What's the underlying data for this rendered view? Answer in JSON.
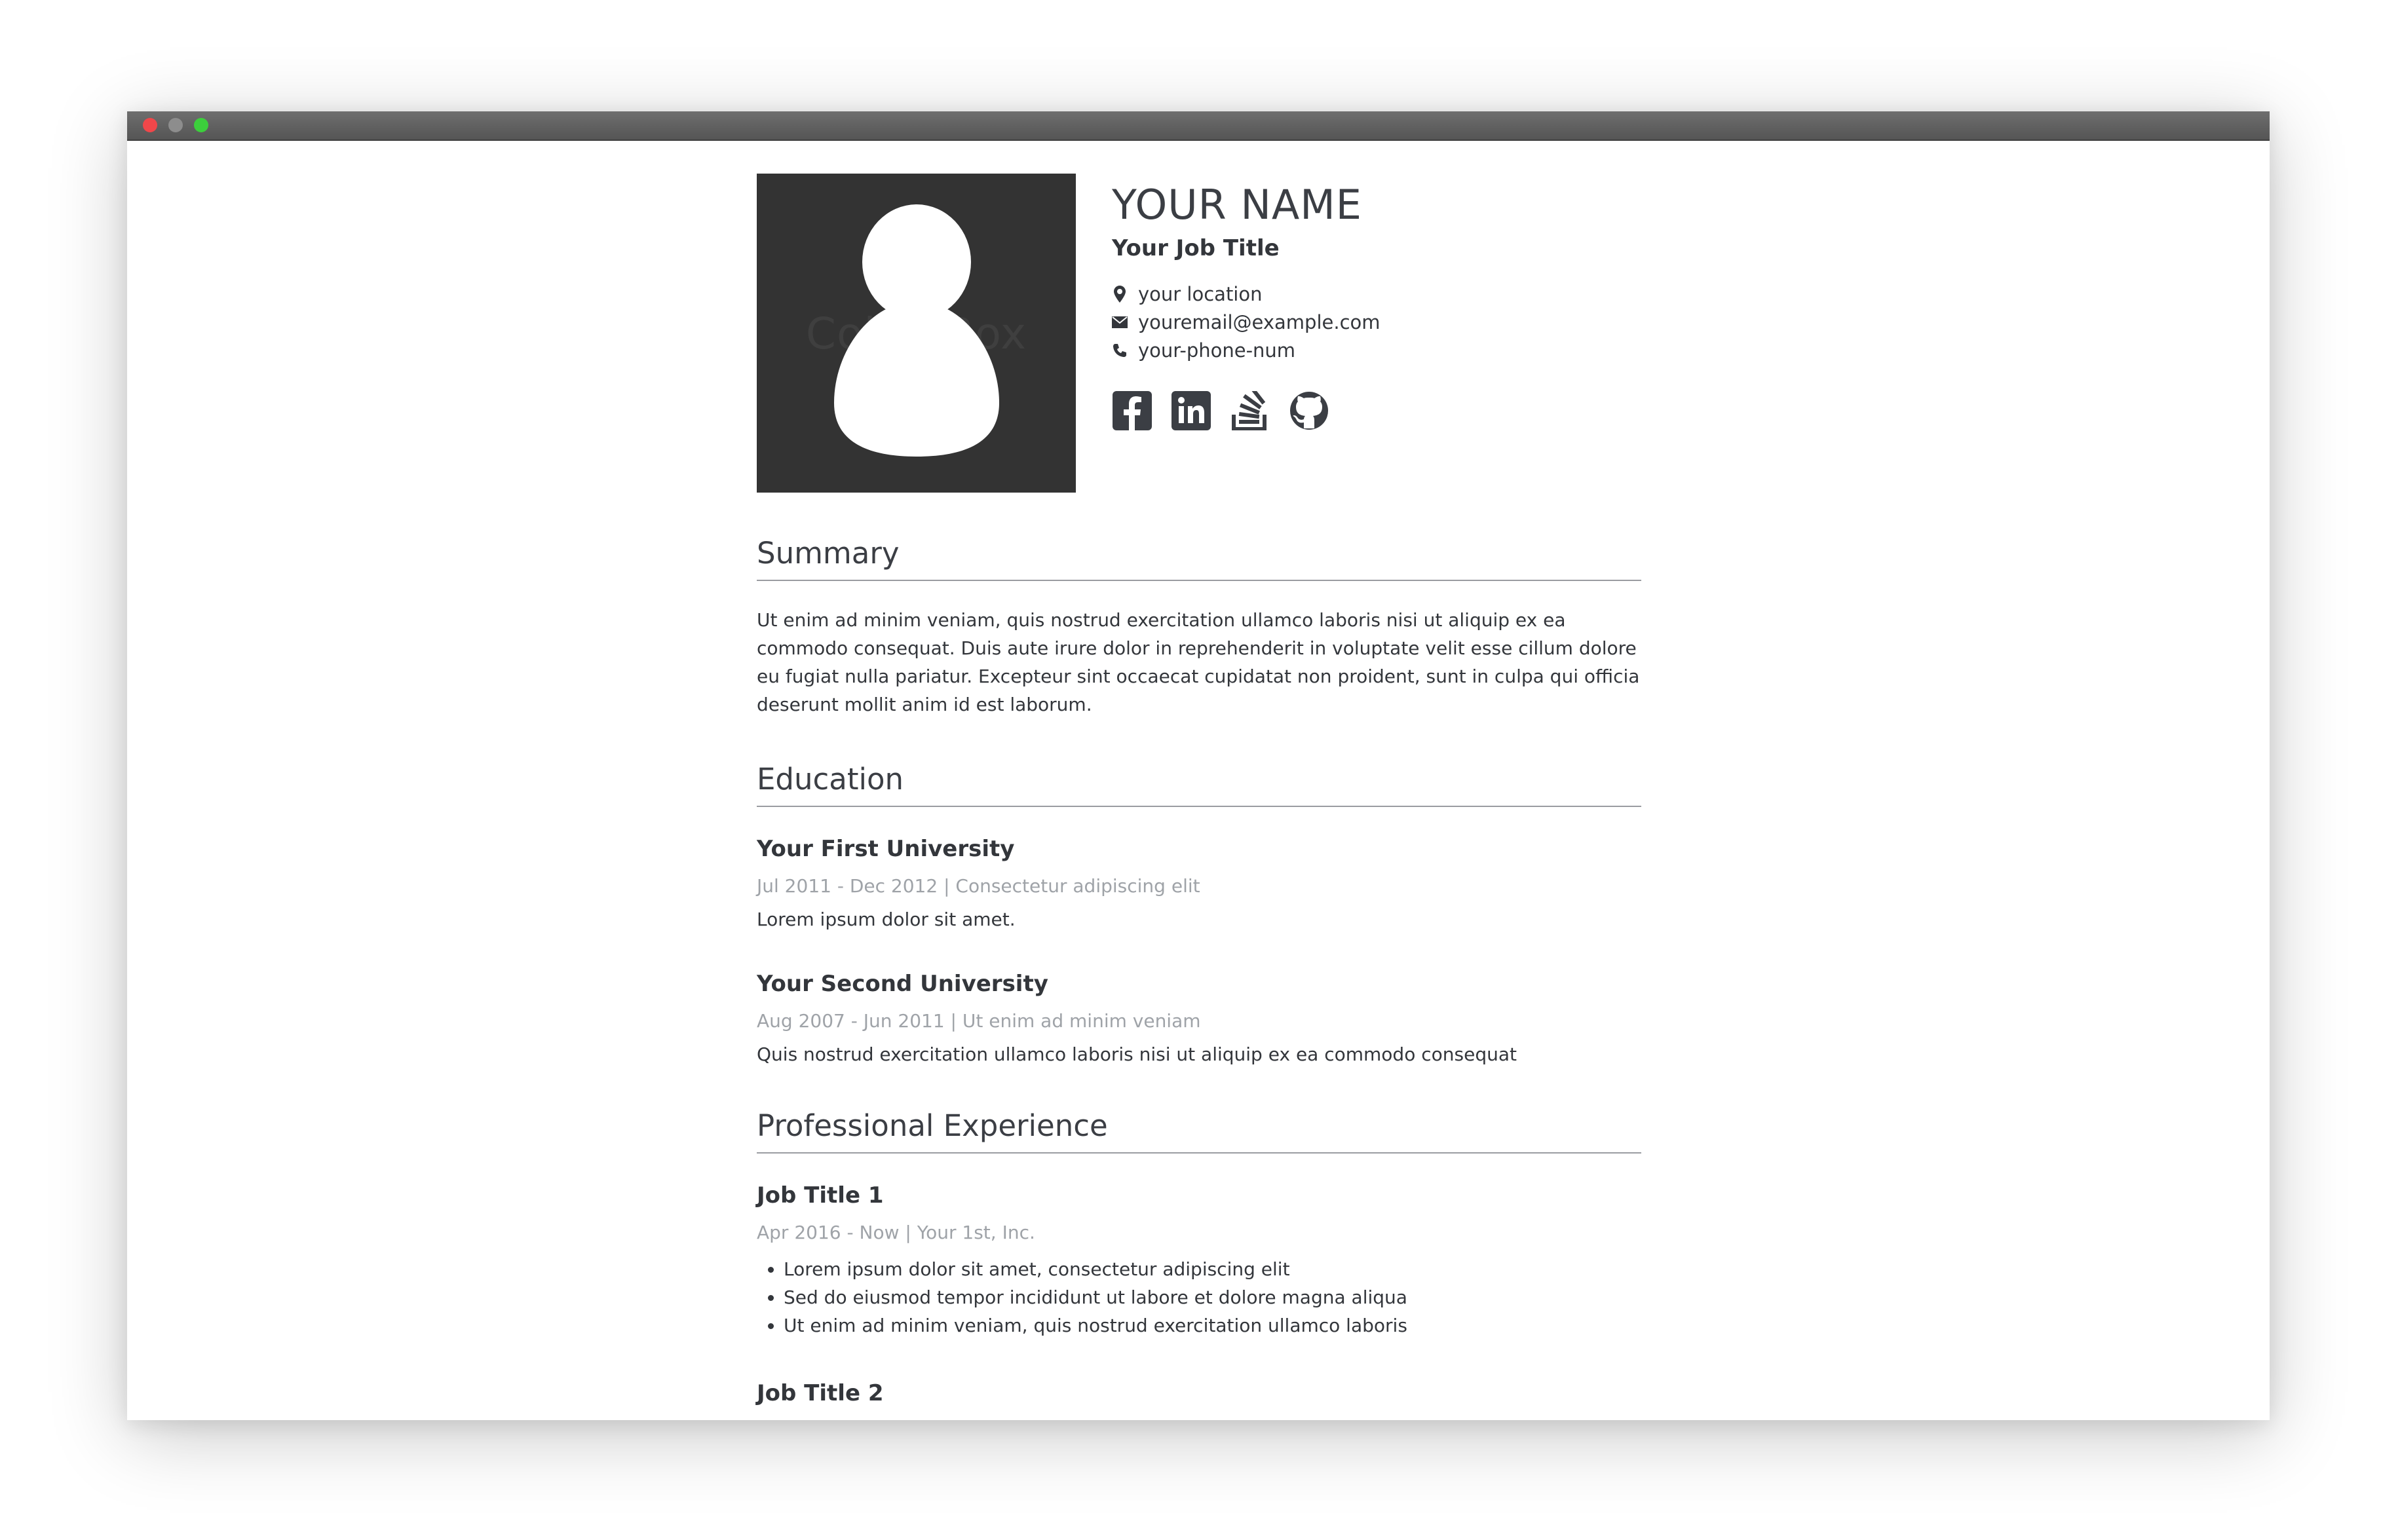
{
  "window": {
    "controls": [
      "close",
      "minimize",
      "maximize"
    ]
  },
  "profile": {
    "photo_watermark": "CollabBox",
    "name": "YOUR NAME",
    "job_title": "Your Job Title",
    "location": "your location",
    "email": "youremail@example.com",
    "phone": "your-phone-num",
    "location_icon": "map-marker-icon",
    "email_icon": "envelope-icon",
    "phone_icon": "phone-icon",
    "socials": [
      "facebook-icon",
      "linkedin-icon",
      "stackoverflow-icon",
      "github-icon"
    ]
  },
  "summary": {
    "title": "Summary",
    "text": "Ut enim ad minim veniam, quis nostrud exercitation ullamco laboris nisi ut aliquip ex ea commodo consequat. Duis aute irure dolor in reprehenderit in voluptate velit esse cillum dolore eu fugiat nulla pariatur. Excepteur sint occaecat cupidatat non proident, sunt in culpa qui officia deserunt mollit anim id est laborum."
  },
  "education": {
    "title": "Education",
    "items": [
      {
        "title": "Your First University",
        "meta": "Jul 2011 - Dec 2012 | Consectetur adipiscing elit",
        "desc": "Lorem ipsum dolor sit amet."
      },
      {
        "title": "Your Second University",
        "meta": "Aug 2007 - Jun 2011 | Ut enim ad minim veniam",
        "desc": "Quis nostrud exercitation ullamco laboris nisi ut aliquip ex ea commodo consequat"
      }
    ]
  },
  "experience": {
    "title": "Professional Experience",
    "items": [
      {
        "title": "Job Title 1",
        "meta": "Apr 2016 - Now | Your 1st, Inc.",
        "bullets": [
          "Lorem ipsum dolor sit amet, consectetur adipiscing elit",
          "Sed do eiusmod tempor incididunt ut labore et dolore magna aliqua",
          "Ut enim ad minim veniam, quis nostrud exercitation ullamco laboris"
        ]
      },
      {
        "title": "Job Title 2"
      }
    ]
  },
  "colors": {
    "titlebar": "#5f5f5f",
    "close": "#f0474a",
    "minimize": "#8d8d8d",
    "maximize": "#3ccf3c",
    "text": "#33363b",
    "muted": "#9fa3a8",
    "photo_bg": "#333333"
  }
}
